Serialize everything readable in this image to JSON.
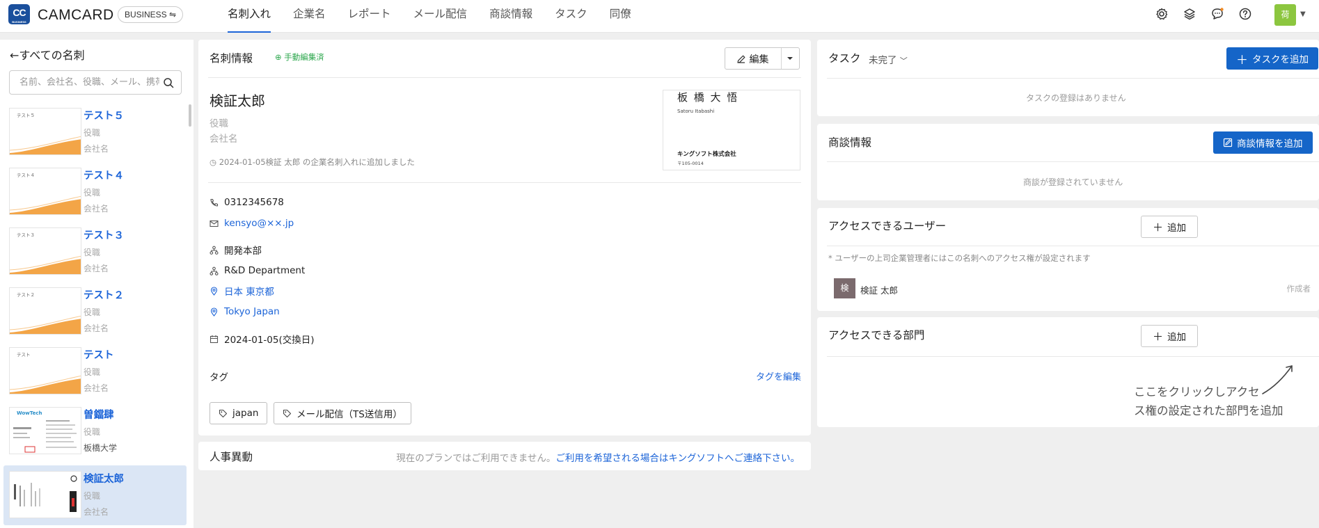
{
  "topbar": {
    "logo_mark": "CC",
    "logo_mark_sub": "BUSINESS",
    "app_name": "CAMCARD",
    "edition": "BUSINESS ⇋",
    "nav": [
      "名刺入れ",
      "企業名",
      "レポート",
      "メール配信",
      "商談情報",
      "タスク",
      "同僚"
    ],
    "active_nav": "名刺入れ",
    "icons": [
      "settings-icon",
      "layers-icon",
      "chat-icon",
      "help-icon"
    ],
    "user_avatar": "荷"
  },
  "sidebar": {
    "back_label": "すべての名刺",
    "search_placeholder": "名前、会社名、役職、メール、携帯",
    "cards": [
      {
        "name": "テスト５",
        "thumb_label": "テスト５",
        "role": "役職",
        "company": "会社名"
      },
      {
        "name": "テスト４",
        "thumb_label": "テスト４",
        "role": "役職",
        "company": "会社名"
      },
      {
        "name": "テスト３",
        "thumb_label": "テスト３",
        "role": "役職",
        "company": "会社名"
      },
      {
        "name": "テスト２",
        "thumb_label": "テスト２",
        "role": "役職",
        "company": "会社名"
      },
      {
        "name": "テスト",
        "thumb_label": "テスト",
        "role": "役職",
        "company": "会社名"
      },
      {
        "name": "曽鐺肆",
        "thumb_label": "WowTech",
        "role": "役職",
        "company": "板橋大学"
      },
      {
        "name": "検証太郎",
        "thumb_label": "",
        "role": "役職",
        "company": "会社名"
      }
    ],
    "selected_index": 6
  },
  "detail": {
    "title": "名刺情報",
    "manual_badge": "手動編集済",
    "edit_label": "編集",
    "name": "検証太郎",
    "role": "役職",
    "company": "会社名",
    "history": "2024-01-05検証  太郎 の企業名刺入れに追加しました",
    "card_image": {
      "name": "板 橋  大 悟",
      "romaji": "Satoru Itabashi",
      "company": "キングソフト株式会社",
      "postal": "〒105-0014"
    },
    "phone": "0312345678",
    "email": "kensyo@××.jp",
    "department_jp": "開発本部",
    "department_en": "R&D Department",
    "address_jp": "日本 東京都",
    "address_en": "Tokyo Japan",
    "exchange_date": "2024-01-05(交換日)",
    "tags_label": "タグ",
    "tags_edit": "タグを編集",
    "tags": [
      "japan",
      "メール配信（TS送信用）"
    ]
  },
  "hr": {
    "title": "人事異動",
    "note": "現在のプランではご利用できません。",
    "note_link": "ご利用を希望される場合はキングソフトへご連絡下さい。"
  },
  "tasks": {
    "title": "タスク",
    "filter": "未完了",
    "add_label": "タスクを追加",
    "empty": "タスクの登録はありません"
  },
  "deals": {
    "title": "商談情報",
    "add_label": "商談情報を追加",
    "empty": "商談が登録されていません"
  },
  "access_users": {
    "title": "アクセスできるユーザー",
    "add_label": "追加",
    "note": "* ユーザーの上司企業管理者にはこの名刺へのアクセス権が設定されます",
    "user_initial": "検",
    "user_name": "検証  太郎",
    "user_role": "作成者"
  },
  "access_depts": {
    "title": "アクセスできる部門",
    "add_label": "追加",
    "hint_line1": "ここをクリックしアクセ",
    "hint_line2": "ス権の設定された部門を追加"
  },
  "colors": {
    "accent": "#1c64d8",
    "button": "#1565c8",
    "badge_green": "#2fa84f",
    "selected_bg": "#dbe6f5",
    "avatar_green": "#8cc63f"
  }
}
